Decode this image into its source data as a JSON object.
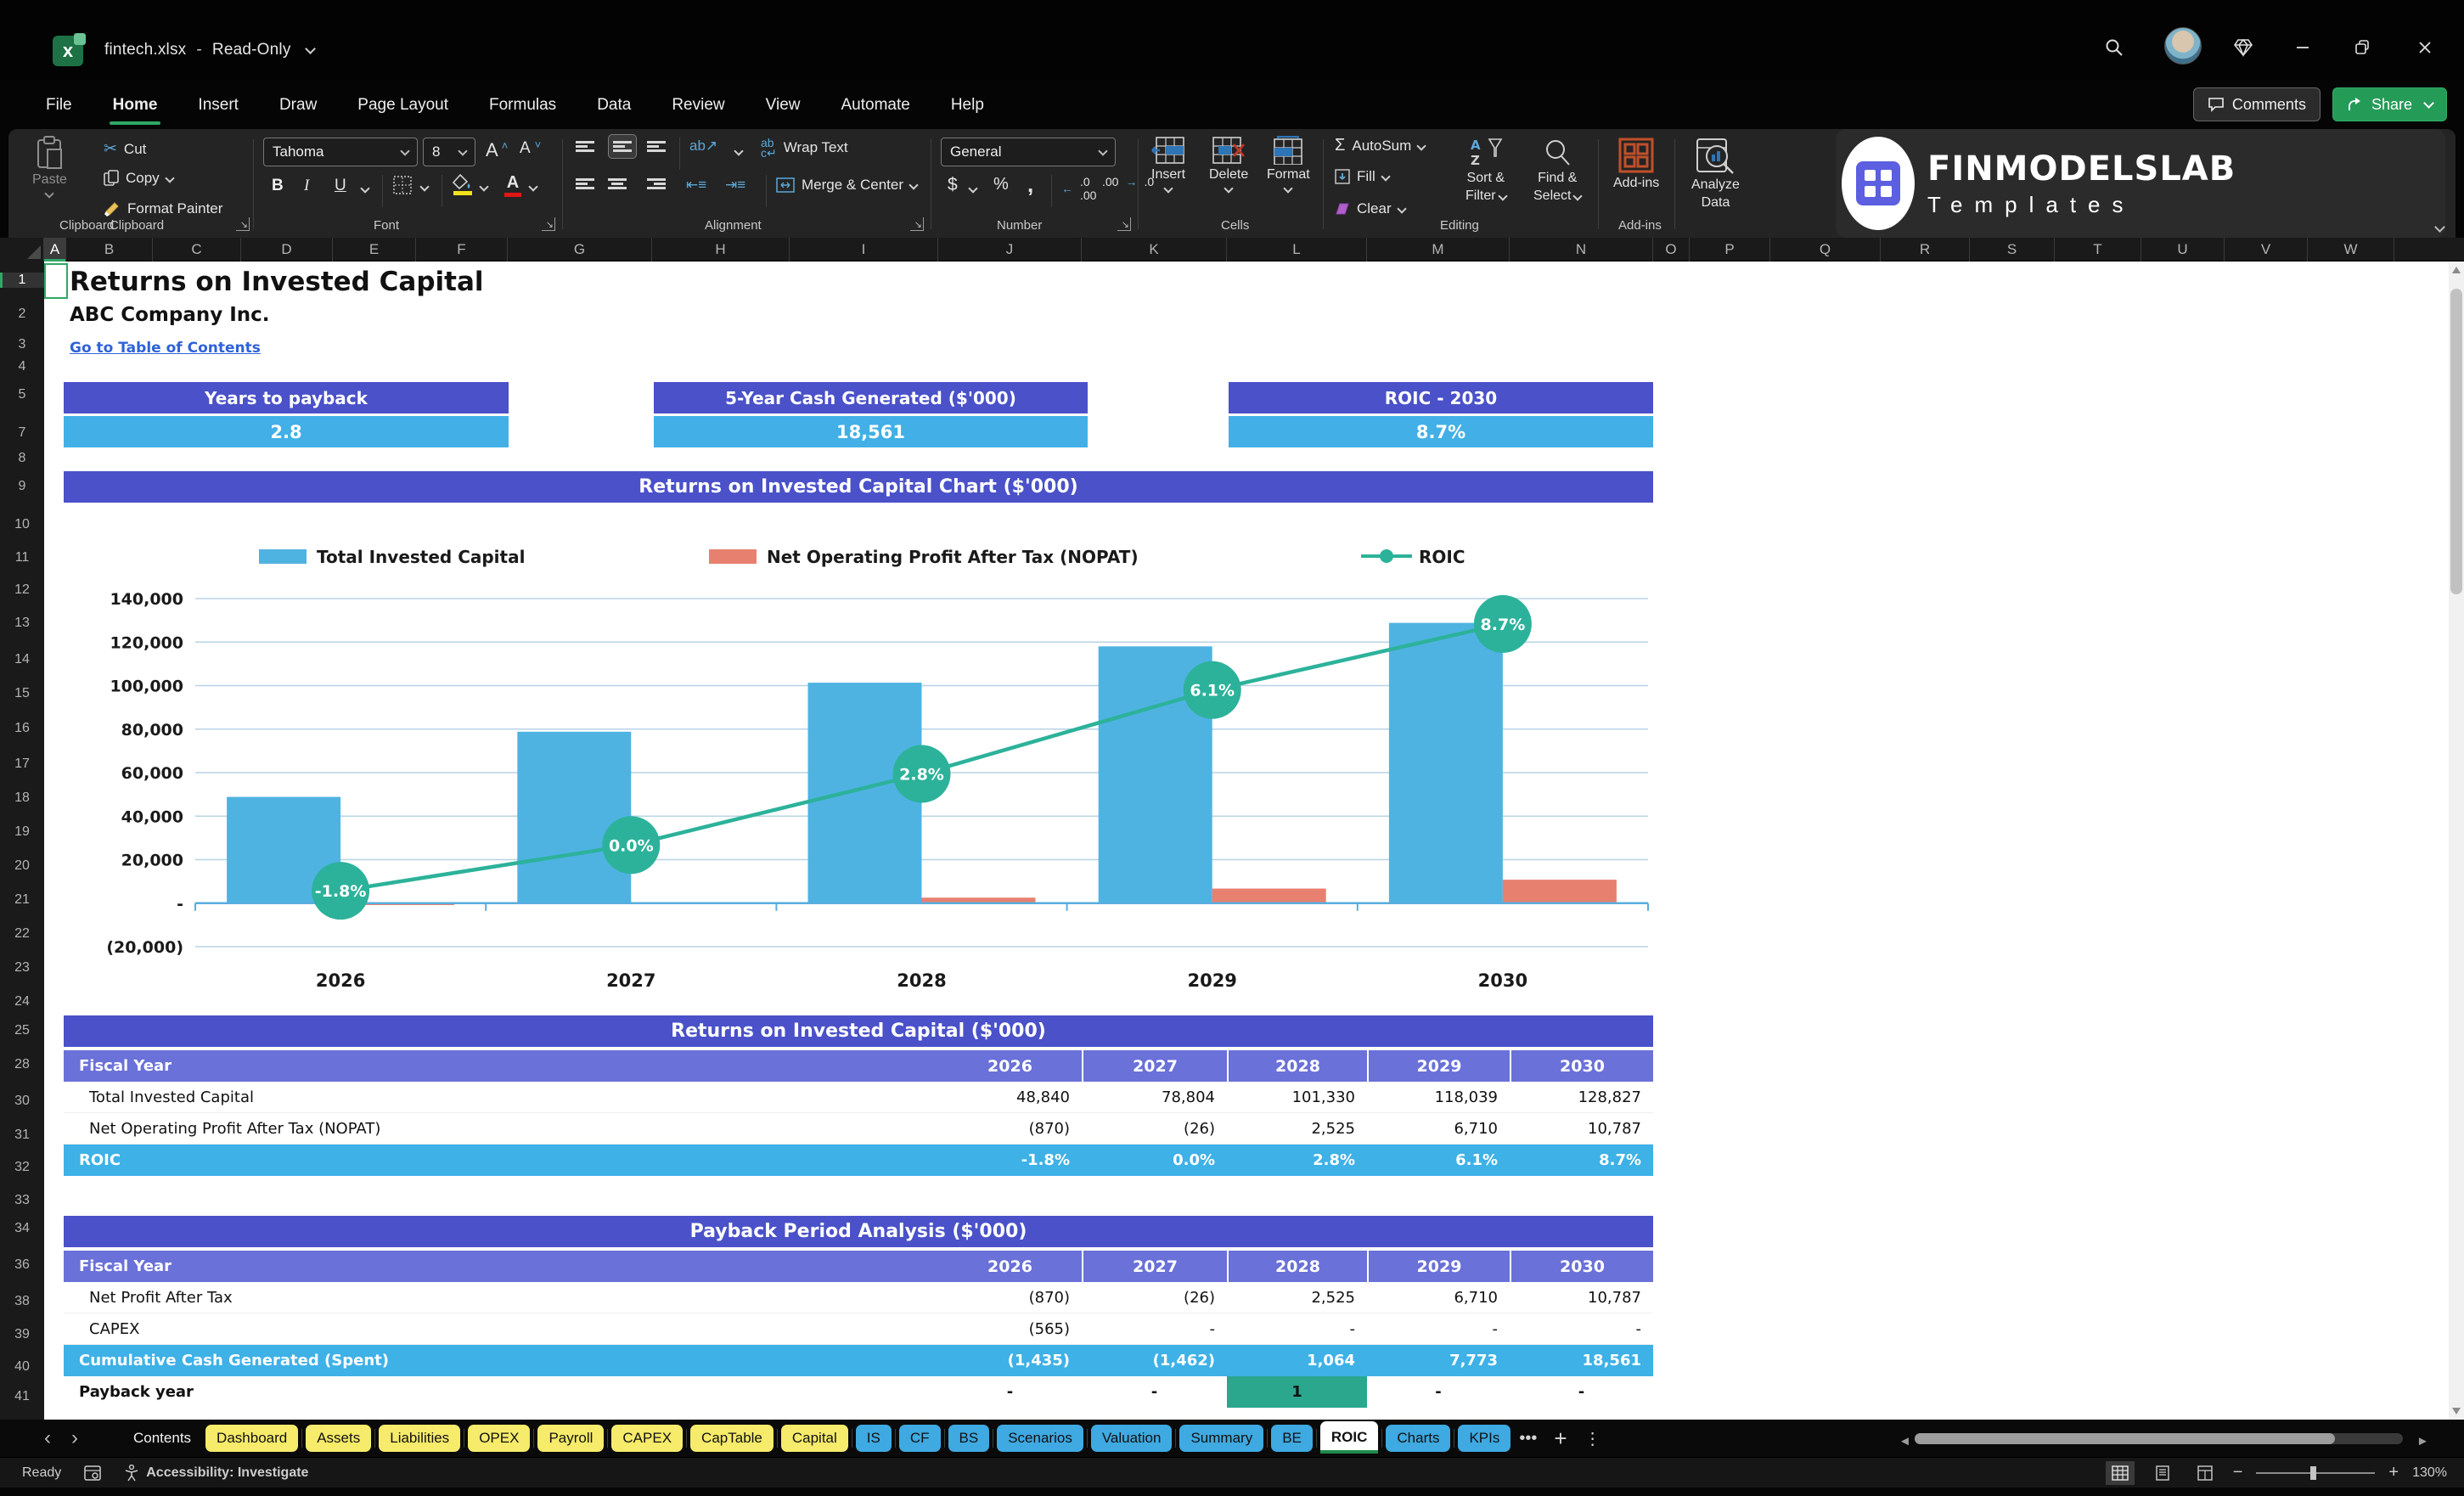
{
  "titlebar": {
    "file_name": "fintech.xlsx",
    "separator": "-",
    "mode": "Read-Only"
  },
  "menu": {
    "tabs": [
      {
        "label": "File",
        "active": false
      },
      {
        "label": "Home",
        "active": true
      },
      {
        "label": "Insert",
        "active": false
      },
      {
        "label": "Draw",
        "active": false
      },
      {
        "label": "Page Layout",
        "active": false
      },
      {
        "label": "Formulas",
        "active": false
      },
      {
        "label": "Data",
        "active": false
      },
      {
        "label": "Review",
        "active": false
      },
      {
        "label": "View",
        "active": false
      },
      {
        "label": "Automate",
        "active": false
      },
      {
        "label": "Help",
        "active": false
      }
    ],
    "comments_label": "Comments",
    "share_label": "Share"
  },
  "ribbon": {
    "clipboard": {
      "group_label": "Clipboard",
      "paste": "Paste",
      "cut": "Cut",
      "copy": "Copy",
      "format_painter": "Format Painter"
    },
    "font": {
      "group_label": "Font",
      "font_name": "Tahoma",
      "font_size": "8"
    },
    "alignment": {
      "group_label": "Alignment",
      "wrap_text": "Wrap Text",
      "merge_center": "Merge & Center"
    },
    "number": {
      "group_label": "Number",
      "format": "General"
    },
    "cells": {
      "group_label": "Cells",
      "insert": "Insert",
      "delete": "Delete",
      "format": "Format"
    },
    "editing": {
      "group_label": "Editing",
      "autosum": "AutoSum",
      "fill": "Fill",
      "clear": "Clear",
      "sort_filter_1": "Sort &",
      "sort_filter_2": "Filter",
      "find_select_1": "Find &",
      "find_select_2": "Select"
    },
    "addins": {
      "group_label": "Add-ins",
      "addins_label": "Add-ins",
      "analyze_1": "Analyze",
      "analyze_2": "Data"
    }
  },
  "logo": {
    "title": "FINMODELSLAB",
    "subtitle": "Templates"
  },
  "sheet": {
    "columns": [
      "A",
      "B",
      "C",
      "D",
      "E",
      "F",
      "G",
      "H",
      "I",
      "J",
      "K",
      "L",
      "M",
      "N",
      "O",
      "P",
      "Q",
      "R",
      "S",
      "T",
      "U",
      "V",
      "W"
    ],
    "rows": [
      "1",
      "2",
      "3",
      "4",
      "5",
      "7",
      "8",
      "9",
      "10",
      "11",
      "12",
      "13",
      "14",
      "15",
      "16",
      "17",
      "18",
      "19",
      "20",
      "21",
      "22",
      "23",
      "24",
      "25",
      "28",
      "30",
      "31",
      "32",
      "33",
      "34",
      "36",
      "38",
      "39",
      "40",
      "41"
    ]
  },
  "page": {
    "title": "Returns on Invested Capital",
    "company": "ABC Company Inc.",
    "link": "Go to Table of Contents"
  },
  "kpis": [
    {
      "label": "Years to payback",
      "value": "2.8"
    },
    {
      "label": "5-Year Cash Generated ($'000)",
      "value": "18,561"
    },
    {
      "label": "ROIC - 2030",
      "value": "8.7%"
    }
  ],
  "chart_data": {
    "type": "bar",
    "title": "Returns on Invested Capital Chart ($'000)",
    "categories": [
      "2026",
      "2027",
      "2028",
      "2029",
      "2030"
    ],
    "series": [
      {
        "name": "Total Invested Capital",
        "type": "bar",
        "color": "#4fb3e2",
        "values": [
          48840,
          78804,
          101330,
          118039,
          128827
        ]
      },
      {
        "name": "Net Operating Profit After Tax (NOPAT)",
        "type": "bar",
        "color": "#e88070",
        "values": [
          -870,
          -26,
          2525,
          6710,
          10787
        ]
      },
      {
        "name": "ROIC",
        "type": "line",
        "color": "#2cb29a",
        "axis": "secondary",
        "values": [
          -1.8,
          0.0,
          2.8,
          6.1,
          8.7
        ],
        "labels": [
          "-1.8%",
          "0.0%",
          "2.8%",
          "6.1%",
          "8.7%"
        ]
      }
    ],
    "ylim": [
      -20000,
      140000
    ],
    "ytick_step": 20000,
    "ytick_labels": [
      "140,000",
      "120,000",
      "100,000",
      "80,000",
      "60,000",
      "40,000",
      "20,000",
      "-",
      "(20,000)"
    ],
    "secondary_ylim": [
      -4,
      9.7
    ],
    "grid": true,
    "legend_position": "top",
    "xlabel": "",
    "ylabel": ""
  },
  "tables": [
    {
      "banner": "Returns on Invested Capital ($'000)",
      "header_label": "Fiscal Year",
      "years": [
        "2026",
        "2027",
        "2028",
        "2029",
        "2030"
      ],
      "rows": [
        {
          "label": "Total Invested Capital",
          "values": [
            "48,840",
            "78,804",
            "101,330",
            "118,039",
            "128,827"
          ],
          "style": "plain",
          "align": "right"
        },
        {
          "label": "Net Operating Profit After Tax (NOPAT)",
          "values": [
            "(870)",
            "(26)",
            "2,525",
            "6,710",
            "10,787"
          ],
          "style": "plain",
          "align": "right"
        },
        {
          "label": "ROIC",
          "values": [
            "-1.8%",
            "0.0%",
            "2.8%",
            "6.1%",
            "8.7%"
          ],
          "style": "hblue",
          "align": "right"
        }
      ]
    },
    {
      "banner": "Payback Period Analysis ($'000)",
      "header_label": "Fiscal Year",
      "years": [
        "2026",
        "2027",
        "2028",
        "2029",
        "2030"
      ],
      "rows": [
        {
          "label": "Net Profit After Tax",
          "values": [
            "(870)",
            "(26)",
            "2,525",
            "6,710",
            "10,787"
          ],
          "style": "plain",
          "align": "right"
        },
        {
          "label": "CAPEX",
          "values": [
            "(565)",
            "-",
            "-",
            "-",
            "-"
          ],
          "style": "plain",
          "align": "right"
        },
        {
          "label": "Cumulative Cash Generated (Spent)",
          "values": [
            "(1,435)",
            "(1,462)",
            "1,064",
            "7,773",
            "18,561"
          ],
          "style": "hblue",
          "align": "right"
        },
        {
          "label": "Payback year",
          "values": [
            "-",
            "-",
            "1",
            "-",
            "-"
          ],
          "style": "payback",
          "align": "center",
          "highlight_index": 2
        }
      ]
    }
  ],
  "sheet_tabs": {
    "tabs": [
      {
        "label": "Contents",
        "style": "plain"
      },
      {
        "label": "Dashboard",
        "style": "yellow"
      },
      {
        "label": "Assets",
        "style": "yellow"
      },
      {
        "label": "Liabilities",
        "style": "yellow"
      },
      {
        "label": "OPEX",
        "style": "yellow"
      },
      {
        "label": "Payroll",
        "style": "yellow"
      },
      {
        "label": "CAPEX",
        "style": "yellow"
      },
      {
        "label": "CapTable",
        "style": "yellow"
      },
      {
        "label": "Capital",
        "style": "yellow"
      },
      {
        "label": "IS",
        "style": "blue"
      },
      {
        "label": "CF",
        "style": "blue"
      },
      {
        "label": "BS",
        "style": "blue"
      },
      {
        "label": "Scenarios",
        "style": "blue"
      },
      {
        "label": "Valuation",
        "style": "blue"
      },
      {
        "label": "Summary",
        "style": "blue"
      },
      {
        "label": "BE",
        "style": "blue"
      },
      {
        "label": "ROIC",
        "style": "active"
      },
      {
        "label": "Charts",
        "style": "blue"
      },
      {
        "label": "KPIs",
        "style": "blue"
      }
    ],
    "more": "•••",
    "add": "+",
    "menu": "⋮"
  },
  "statusbar": {
    "ready": "Ready",
    "accessibility": "Accessibility: Investigate",
    "zoom": "130%"
  }
}
